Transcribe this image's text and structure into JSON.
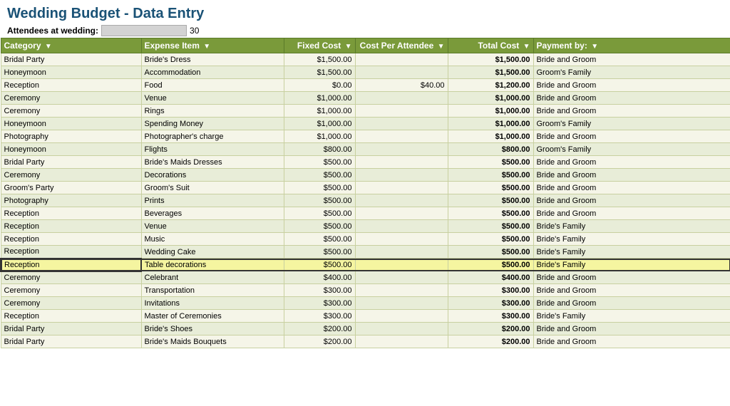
{
  "title": "Wedding Budget - Data Entry",
  "attendees_label": "Attendees at wedding:",
  "attendees_value": "30",
  "headers": {
    "category": "Category",
    "expense": "Expense Item",
    "fixed": "Fixed Cost",
    "per_attendee": "Cost Per Attendee",
    "total": "Total Cost",
    "payment": "Payment by:"
  },
  "rows": [
    {
      "category": "Bridal Party",
      "expense": "Bride's Dress",
      "fixed": "$1,500.00",
      "per": "",
      "total": "$1,500.00",
      "payment": "Bride and Groom",
      "highlight": false
    },
    {
      "category": "Honeymoon",
      "expense": "Accommodation",
      "fixed": "$1,500.00",
      "per": "",
      "total": "$1,500.00",
      "payment": "Groom's Family",
      "highlight": false
    },
    {
      "category": "Reception",
      "expense": "Food",
      "fixed": "$0.00",
      "per": "$40.00",
      "total": "$1,200.00",
      "payment": "Bride and Groom",
      "highlight": false
    },
    {
      "category": "Ceremony",
      "expense": "Venue",
      "fixed": "$1,000.00",
      "per": "",
      "total": "$1,000.00",
      "payment": "Bride and Groom",
      "highlight": false
    },
    {
      "category": "Ceremony",
      "expense": "Rings",
      "fixed": "$1,000.00",
      "per": "",
      "total": "$1,000.00",
      "payment": "Bride and Groom",
      "highlight": false
    },
    {
      "category": "Honeymoon",
      "expense": "Spending Money",
      "fixed": "$1,000.00",
      "per": "",
      "total": "$1,000.00",
      "payment": "Groom's Family",
      "highlight": false
    },
    {
      "category": "Photography",
      "expense": "Photographer's charge",
      "fixed": "$1,000.00",
      "per": "",
      "total": "$1,000.00",
      "payment": "Bride and Groom",
      "highlight": false
    },
    {
      "category": "Honeymoon",
      "expense": "Flights",
      "fixed": "$800.00",
      "per": "",
      "total": "$800.00",
      "payment": "Groom's Family",
      "highlight": false
    },
    {
      "category": "Bridal Party",
      "expense": "Bride's Maids Dresses",
      "fixed": "$500.00",
      "per": "",
      "total": "$500.00",
      "payment": "Bride and Groom",
      "highlight": false
    },
    {
      "category": "Ceremony",
      "expense": "Decorations",
      "fixed": "$500.00",
      "per": "",
      "total": "$500.00",
      "payment": "Bride and Groom",
      "highlight": false
    },
    {
      "category": "Groom's Party",
      "expense": "Groom's Suit",
      "fixed": "$500.00",
      "per": "",
      "total": "$500.00",
      "payment": "Bride and Groom",
      "highlight": false
    },
    {
      "category": "Photography",
      "expense": "Prints",
      "fixed": "$500.00",
      "per": "",
      "total": "$500.00",
      "payment": "Bride and Groom",
      "highlight": false
    },
    {
      "category": "Reception",
      "expense": "Beverages",
      "fixed": "$500.00",
      "per": "",
      "total": "$500.00",
      "payment": "Bride and Groom",
      "highlight": false
    },
    {
      "category": "Reception",
      "expense": "Venue",
      "fixed": "$500.00",
      "per": "",
      "total": "$500.00",
      "payment": "Bride's Family",
      "highlight": false
    },
    {
      "category": "Reception",
      "expense": "Music",
      "fixed": "$500.00",
      "per": "",
      "total": "$500.00",
      "payment": "Bride's Family",
      "highlight": false
    },
    {
      "category": "Reception",
      "expense": "Wedding Cake",
      "fixed": "$500.00",
      "per": "",
      "total": "$500.00",
      "payment": "Bride's Family",
      "highlight": false
    },
    {
      "category": "Reception",
      "expense": "Table decorations",
      "fixed": "$500.00",
      "per": "",
      "total": "$500.00",
      "payment": "Bride's Family",
      "highlight": true
    },
    {
      "category": "Ceremony",
      "expense": "Celebrant",
      "fixed": "$400.00",
      "per": "",
      "total": "$400.00",
      "payment": "Bride and Groom",
      "highlight": false
    },
    {
      "category": "Ceremony",
      "expense": "Transportation",
      "fixed": "$300.00",
      "per": "",
      "total": "$300.00",
      "payment": "Bride and Groom",
      "highlight": false
    },
    {
      "category": "Ceremony",
      "expense": "Invitations",
      "fixed": "$300.00",
      "per": "",
      "total": "$300.00",
      "payment": "Bride and Groom",
      "highlight": false
    },
    {
      "category": "Reception",
      "expense": "Master of Ceremonies",
      "fixed": "$300.00",
      "per": "",
      "total": "$300.00",
      "payment": "Bride's Family",
      "highlight": false
    },
    {
      "category": "Bridal Party",
      "expense": "Bride's Shoes",
      "fixed": "$200.00",
      "per": "",
      "total": "$200.00",
      "payment": "Bride and Groom",
      "highlight": false
    },
    {
      "category": "Bridal Party",
      "expense": "Bride's Maids Bouquets",
      "fixed": "$200.00",
      "per": "",
      "total": "$200.00",
      "payment": "Bride and Groom",
      "highlight": false
    }
  ]
}
